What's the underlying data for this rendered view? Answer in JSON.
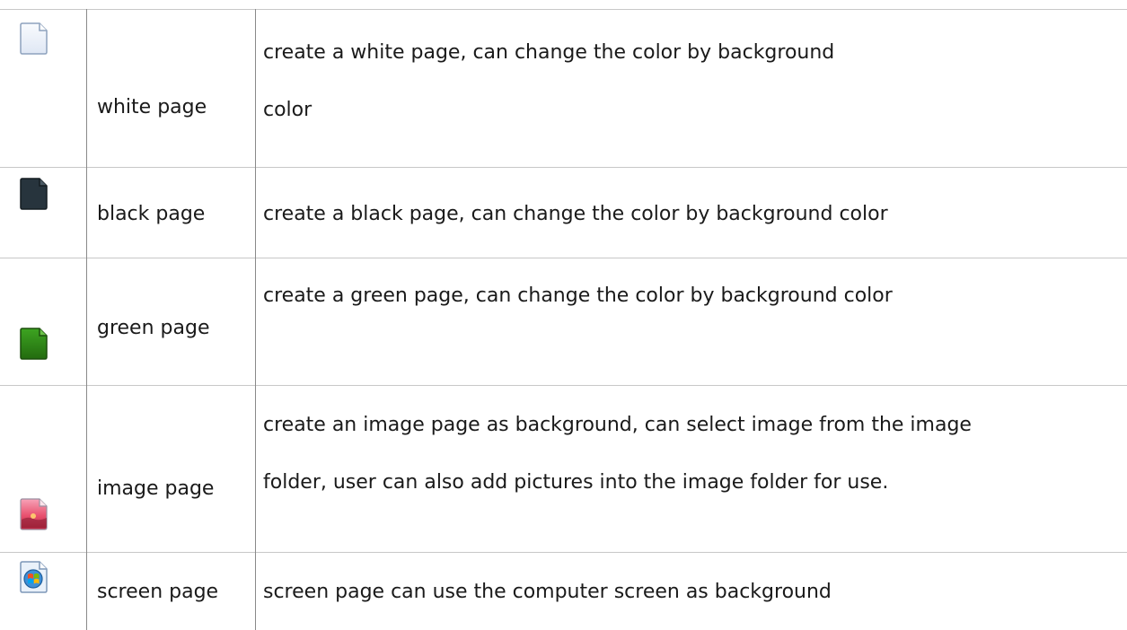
{
  "table": {
    "rows": [
      {
        "icon": "white-page-icon",
        "name": "white page",
        "description_lines": [
          "create a white page, can change the color by background",
          "color"
        ]
      },
      {
        "icon": "black-page-icon",
        "name": "black page",
        "description_lines": [
          "create a black page, can change the color by background color"
        ]
      },
      {
        "icon": "green-page-icon",
        "name": "green page",
        "description_lines": [
          "create a green page, can change the color by background color"
        ]
      },
      {
        "icon": "image-page-icon",
        "name": "image page",
        "description_lines": [
          "create an image page as background, can select image from the image",
          "folder, user can also add pictures into the image folder for use."
        ]
      },
      {
        "icon": "screen-page-icon",
        "name": "screen page",
        "description_lines": [
          "screen page can use the computer screen as background"
        ]
      }
    ]
  },
  "colors": {
    "border_horizontal": "#c8c8c8",
    "border_vertical": "#8a8a8a",
    "text": "#1a1a1a",
    "white_page_fill": "#eef3fb",
    "black_page_fill": "#27343d",
    "green_page_fill": "#2e8b16",
    "image_page_fill": "#e8506e",
    "screen_page_fill": "#3e8fd6"
  }
}
